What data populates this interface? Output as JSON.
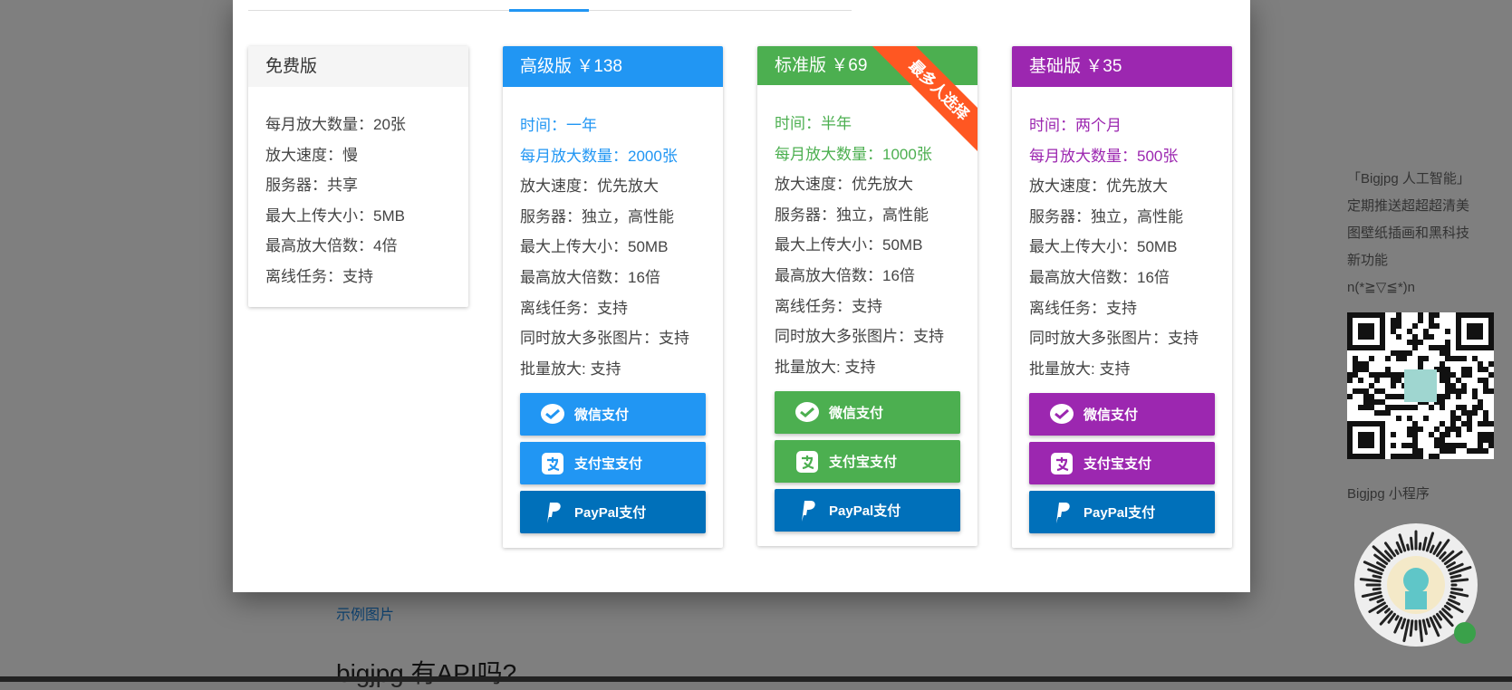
{
  "background": {
    "link": "示例图片",
    "heading": "bigjpg 有API吗?"
  },
  "side": {
    "lines": [
      "「Bigjpg 人工智能」",
      "定期推送超超超清美",
      "图壁纸插画和黑科技",
      "新功能",
      "n(*≧▽≦*)n"
    ],
    "mini_label": "Bigjpg 小程序"
  },
  "plans": [
    {
      "title": "免费版",
      "rows": [
        "每月放大数量：20张",
        "放大速度：慢",
        "服务器：共享",
        "最大上传大小：5MB",
        "最高放大倍数：4倍",
        "离线任务：支持"
      ]
    },
    {
      "title": "高级版 ￥138",
      "color": "#2196f3",
      "rows": [
        "时间：一年",
        "每月放大数量：2000张",
        "放大速度：优先放大",
        "服务器：独立，高性能",
        "最大上传大小：50MB",
        "最高放大倍数：16倍",
        "离线任务：支持",
        "同时放大多张图片：支持",
        "批量放大: 支持"
      ]
    },
    {
      "title": "标准版 ￥69",
      "color": "#4caf50",
      "ribbon": "最多人选择",
      "rows": [
        "时间：半年",
        "每月放大数量：1000张",
        "放大速度：优先放大",
        "服务器：独立，高性能",
        "最大上传大小：50MB",
        "最高放大倍数：16倍",
        "离线任务：支持",
        "同时放大多张图片：支持",
        "批量放大: 支持"
      ]
    },
    {
      "title": "基础版 ￥35",
      "color": "#9c27b0",
      "rows": [
        "时间：两个月",
        "每月放大数量：500张",
        "放大速度：优先放大",
        "服务器：独立，高性能",
        "最大上传大小：50MB",
        "最高放大倍数：16倍",
        "离线任务：支持",
        "同时放大多张图片：支持",
        "批量放大: 支持"
      ]
    }
  ],
  "pay": {
    "wechat": "微信支付",
    "alipay": "支付宝支付",
    "paypal": "PayPal支付"
  },
  "colors": {
    "paypal": "#0070ba",
    "ribbon": "#ff5722"
  }
}
